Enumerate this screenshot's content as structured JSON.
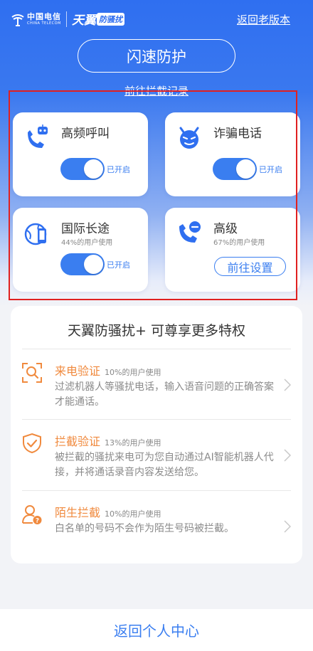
{
  "header": {
    "carrier_cn": "中国电信",
    "carrier_en": "CHINA TELECOM",
    "brand": "天翼",
    "badge": "防骚扰",
    "back_old_version": "返回老版本"
  },
  "hero": {
    "flash_button": "闪速防护",
    "record_link": "前往拦截记录"
  },
  "features": [
    {
      "title": "高频呼叫",
      "usage": "",
      "state": "已开启",
      "icon": "robot-call-icon"
    },
    {
      "title": "诈骗电话",
      "usage": "",
      "state": "已开启",
      "icon": "devil-face-icon"
    },
    {
      "title": "国际长途",
      "usage": "44%的用户使用",
      "state": "已开启",
      "icon": "international-call-icon"
    },
    {
      "title": "高级",
      "usage": "67%的用户使用",
      "button": "前往设置",
      "icon": "phone-minus-icon"
    }
  ],
  "perks": {
    "title": "天翼防骚扰+ 可尊享更多特权",
    "items": [
      {
        "title": "来电验证",
        "usage": "10%的用户使用",
        "desc": "过滤机器人等骚扰电话，输入语音问题的正确答案才能通话。",
        "icon": "scan-face-icon"
      },
      {
        "title": "拦截验证",
        "usage": "13%的用户使用",
        "desc": "被拦截的骚扰来电可为您自动通过AI智能机器人代接，并将通话录音内容发送给您。",
        "icon": "shield-check-icon"
      },
      {
        "title": "陌生拦截",
        "usage": "10%的用户使用",
        "desc": "白名单的号码不会作为陌生号码被拦截。",
        "icon": "stranger-user-icon"
      }
    ]
  },
  "footer": {
    "back_center": "返回个人中心"
  },
  "colors": {
    "primary": "#3a7ef0",
    "accent_orange": "#f08a3e",
    "highlight_red": "#e02020"
  }
}
